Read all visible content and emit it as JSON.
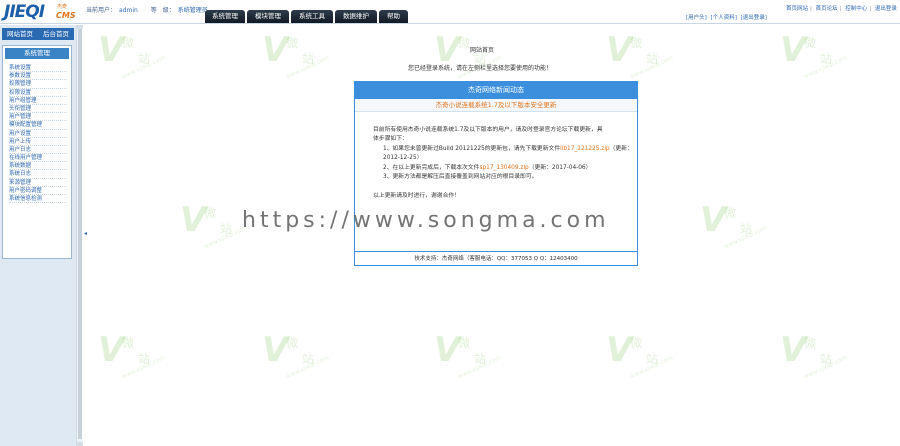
{
  "topbar": {
    "logo_text": "JIEQI",
    "logo_sup": "杰奇",
    "logo_cms": "CMS",
    "user_label": "当前用户：",
    "user_value": "admin",
    "role_label": "等　级：",
    "role_value": "系统管理员",
    "tabs": [
      "系统管理",
      "模块管理",
      "系统工具",
      "数据维护",
      "帮助"
    ],
    "links_left": [
      "[用户头]",
      "[个人资料]",
      "[退出登录]"
    ],
    "links_right": [
      "首页网站",
      "首页论坛",
      "控制中心",
      "退出登录"
    ]
  },
  "sidebar": {
    "head_items": [
      "网站首页",
      "后台首页"
    ],
    "panel_title": "系统管理",
    "items": [
      "系统设置",
      "参数设置",
      "权限管理",
      "权限设置",
      "用户组管理",
      "头衔管理",
      "用户管理",
      "模块配置管理",
      "用户设置",
      "用户上传",
      "用户日志",
      "在线用户管理",
      "系统数据",
      "系统日志",
      "来源管理",
      "用户密码调整",
      "系统信息检测"
    ],
    "collapse_glyph": "◂"
  },
  "main": {
    "title": "网站首页",
    "subtitle": "您已经登录系统，请在左侧栏里选择您要使用的功能！",
    "notice": {
      "header": "杰奇网络新闻动态",
      "warning": "杰奇小说连载系统1.7及以下版本安全更新",
      "body": [
        "目前所有使用杰奇小说连载系统1.7及以下版本的用户，请及时登录官方论坛下载更新，具",
        "体步骤如下：",
        "1、如果您未曾更新过Build 20121225的更新包，请先下载更新文件",
        "2012-12-25）",
        "2、在以上更新完成后，下载本次文件",
        "3、更新方法都是解压后直接覆盖到网站对应的根目录即可。",
        "以上更新请及时进行，谢谢合作！"
      ],
      "file1": "lib17_121225.zip",
      "file1_date": "（更新：",
      "file2": "sp17_130409.zip",
      "file2_date": "（更新：2017-04-06）",
      "footer": "技术支持：杰奇网络（客服电话：QQ：377053  Q Q：12403400"
    }
  },
  "watermark": "https://www.songma.com",
  "background_mark": {
    "glyph": "V",
    "char1": "微",
    "char2": "站",
    "url": "www.vjieqi.com"
  }
}
